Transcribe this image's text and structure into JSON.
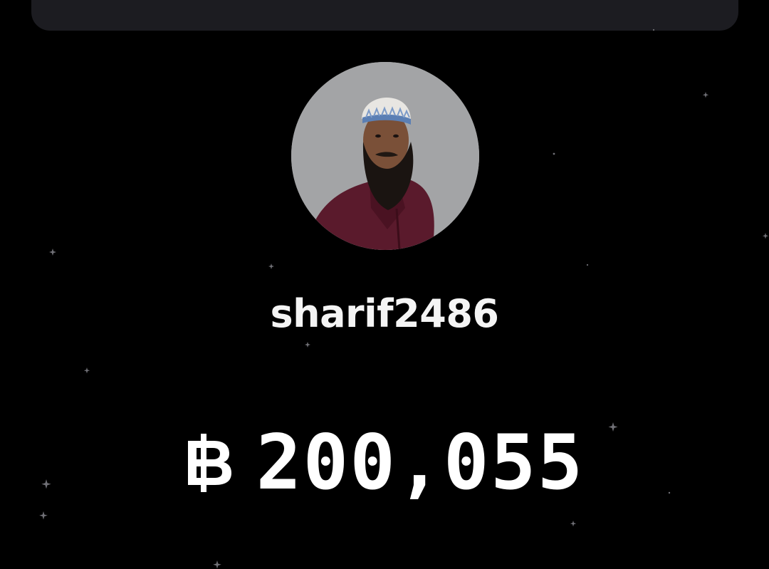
{
  "profile": {
    "username": "sharif2486",
    "avatar_icon": "user-profile-photo"
  },
  "wallet": {
    "currency_icon": "baht-currency-icon",
    "balance": "200,055"
  },
  "colors": {
    "background": "#000000",
    "card": "#1c1c21",
    "text": "#ffffff",
    "star": "#6e6e74"
  }
}
